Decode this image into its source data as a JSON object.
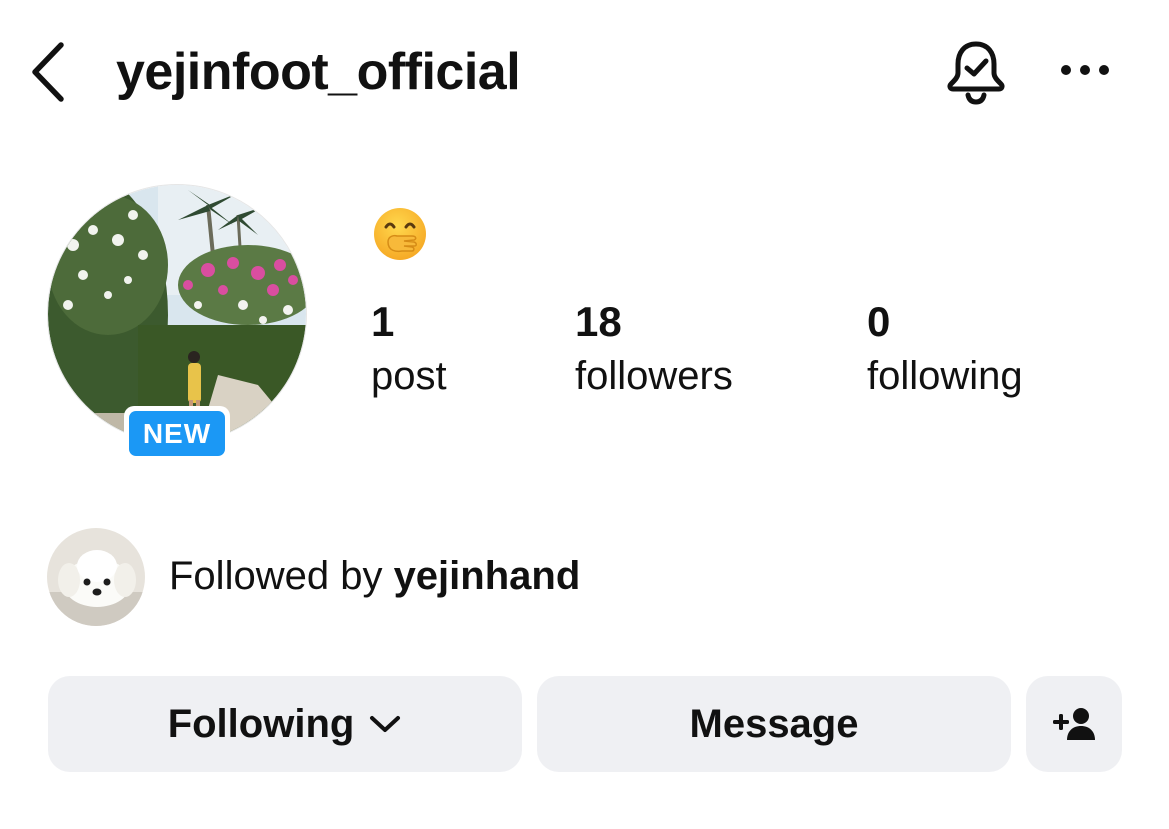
{
  "header": {
    "username": "yejinfoot_official",
    "icons": [
      "chevron-left-icon",
      "bell-check-icon",
      "more-horizontal-icon"
    ]
  },
  "profile": {
    "badge": "NEW",
    "bio_emoji": "face-with-hand-over-mouth",
    "stats": [
      {
        "value": "1",
        "label": "post"
      },
      {
        "value": "18",
        "label": "followers"
      },
      {
        "value": "0",
        "label": "following"
      }
    ]
  },
  "followed_by": {
    "prefix": "Followed by ",
    "user": "yejinhand"
  },
  "actions": {
    "following_label": "Following",
    "message_label": "Message",
    "add_icon": "person-add-icon"
  },
  "colors": {
    "badge_blue": "#1b98f5",
    "button_bg": "#eff0f3",
    "text": "#111111"
  }
}
